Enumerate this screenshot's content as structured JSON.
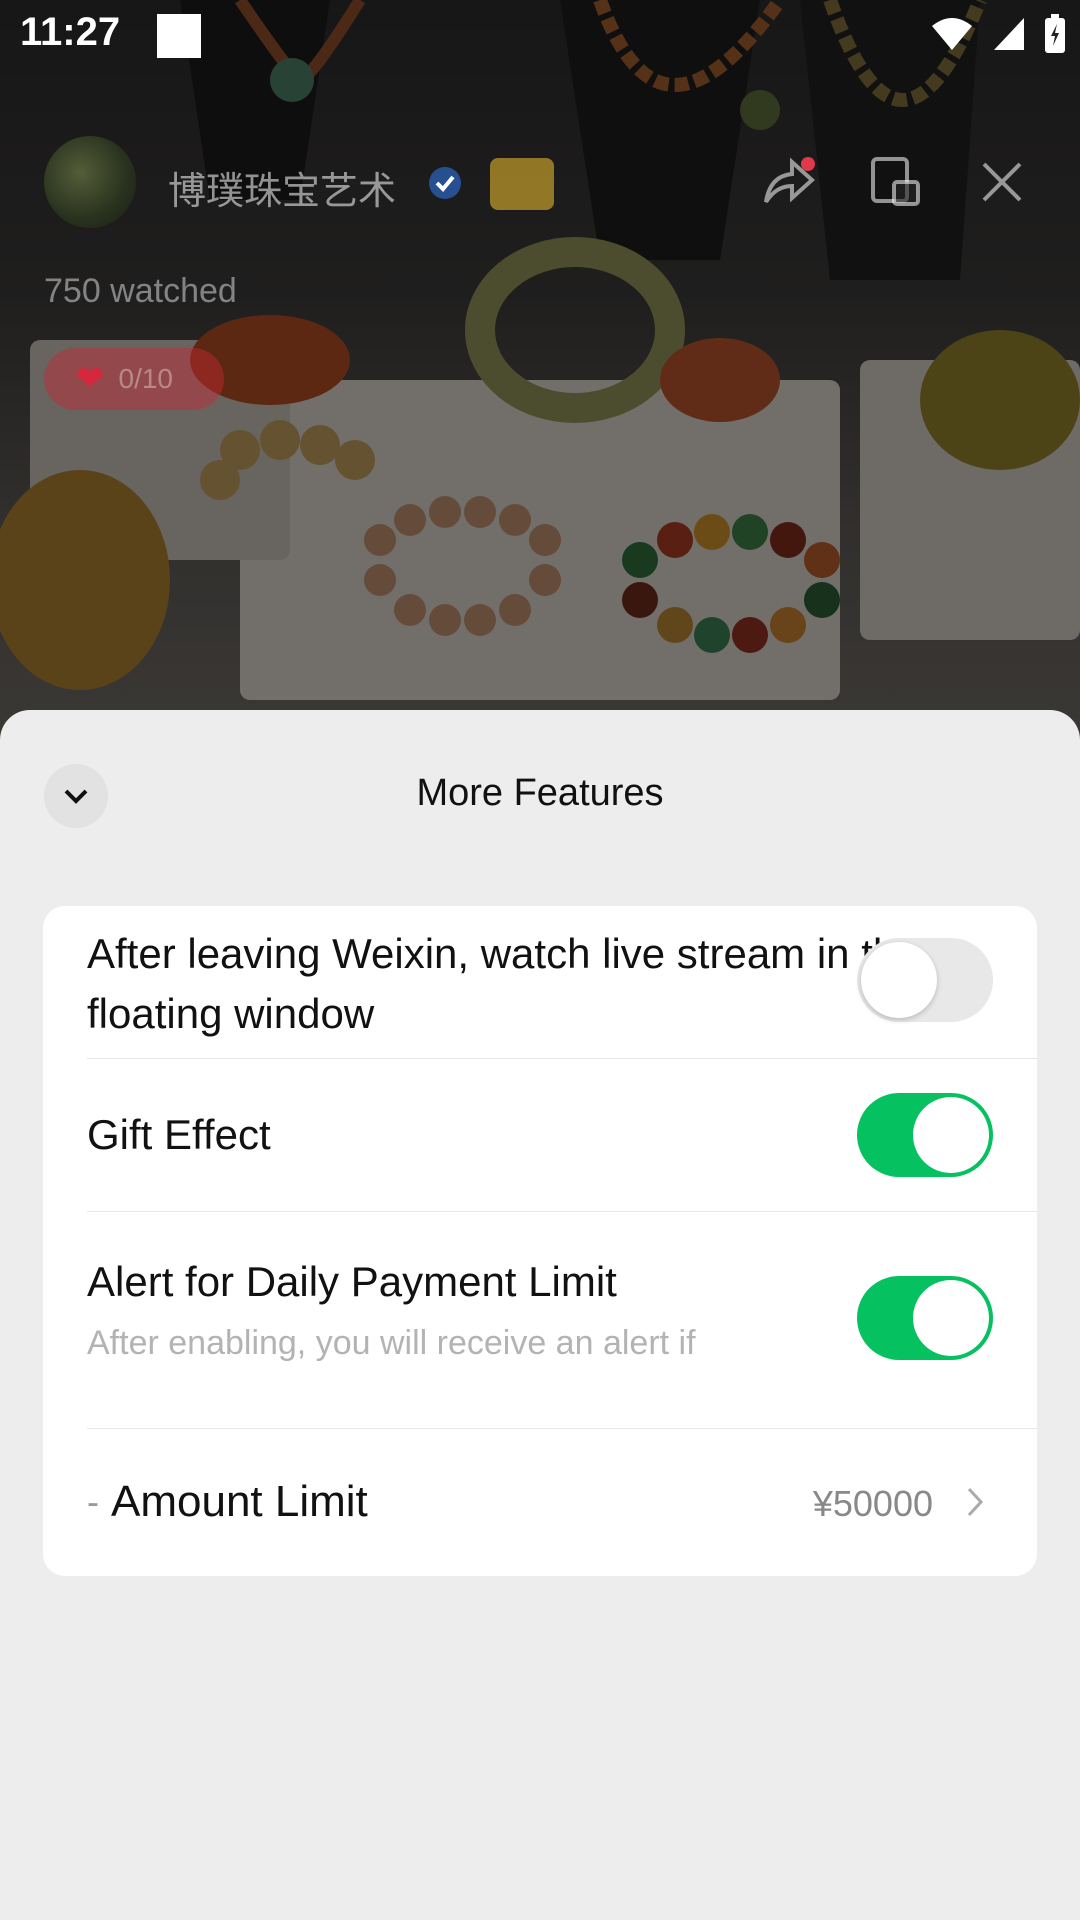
{
  "status_bar": {
    "time": "11:27"
  },
  "live": {
    "channel_name": "博璞珠宝艺术",
    "watched": "750 watched",
    "likes": "0/10"
  },
  "sheet": {
    "title": "More Features",
    "rows": [
      {
        "title": "After leaving Weixin, watch live stream in the floating window",
        "toggle": "off"
      },
      {
        "title": "Gift Effect",
        "toggle": "on"
      },
      {
        "title": "Alert for Daily Payment Limit",
        "description": "After enabling, you will receive an alert if",
        "toggle": "on"
      }
    ],
    "amount": {
      "prefix": "-",
      "label": "Amount Limit",
      "value": "¥50000"
    }
  },
  "colors": {
    "accent_green": "#06c160",
    "sheet_bg": "#ededed"
  }
}
